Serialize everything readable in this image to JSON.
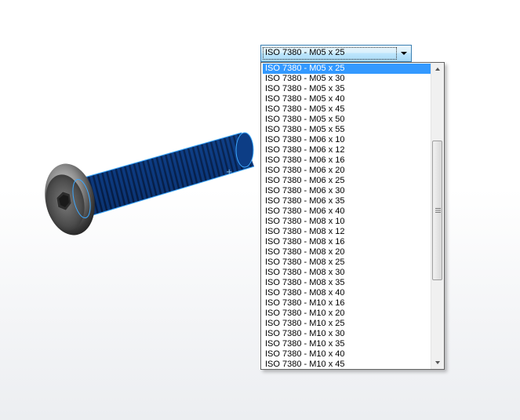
{
  "combo": {
    "selected": "ISO 7380 - M05 x 25"
  },
  "dropdown": {
    "items": [
      "ISO 7380 - M05 x 25",
      "ISO 7380 - M05 x 30",
      "ISO 7380 - M05 x 35",
      "ISO 7380 - M05 x 40",
      "ISO 7380 - M05 x 45",
      "ISO 7380 - M05 x 50",
      "ISO 7380 - M05 x 55",
      "ISO 7380 - M06 x 10",
      "ISO 7380 - M06 x 12",
      "ISO 7380 - M06 x 16",
      "ISO 7380 - M06 x 20",
      "ISO 7380 - M06 x 25",
      "ISO 7380 - M06 x 30",
      "ISO 7380 - M06 x 35",
      "ISO 7380 - M06 x 40",
      "ISO 7380 - M08 x 10",
      "ISO 7380 - M08 x 12",
      "ISO 7380 - M08 x 16",
      "ISO 7380 - M08 x 20",
      "ISO 7380 - M08 x 25",
      "ISO 7380 - M08 x 30",
      "ISO 7380 - M08 x 35",
      "ISO 7380 - M08 x 40",
      "ISO 7380 - M10 x 16",
      "ISO 7380 - M10 x 20",
      "ISO 7380 - M10 x 25",
      "ISO 7380 - M10 x 30",
      "ISO 7380 - M10 x 35",
      "ISO 7380 - M10 x 40",
      "ISO 7380 - M10 x 45"
    ],
    "selected_index": 0
  },
  "colors": {
    "highlight": "#3399ff",
    "thread": "#0a3f8a",
    "selection_edge": "#3da8ff"
  },
  "icons": {
    "combo_arrow": "triangle-down-icon",
    "scroll_up": "triangle-up-icon",
    "scroll_down": "triangle-down-icon"
  }
}
